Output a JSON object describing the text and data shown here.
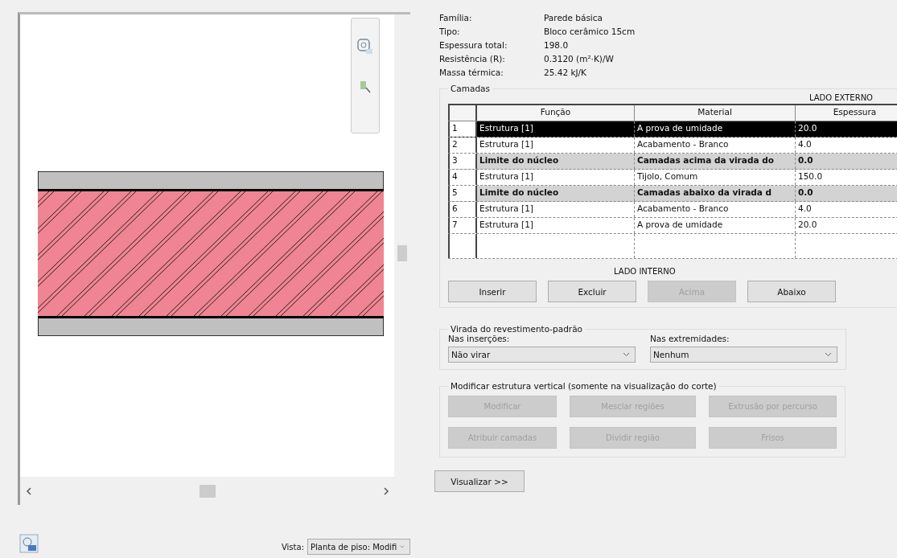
{
  "properties": [
    {
      "label": "Família:",
      "value": "Parede básica"
    },
    {
      "label": "Tipo:",
      "value": "Bloco cerâmico 15cm"
    },
    {
      "label": "Espessura total:",
      "value": "198.0"
    },
    {
      "label": "Resistência (R):",
      "value": "0.3120 (m²·K)/W"
    },
    {
      "label": "Massa térmica:",
      "value": "25.42 kJ/K"
    }
  ],
  "layers": {
    "title": "Camadas",
    "exterior_label": "LADO EXTERNO",
    "interior_label": "LADO INTERNO",
    "columns": [
      "Função",
      "Material",
      "Espessura"
    ],
    "rows": [
      {
        "number": "1",
        "function": "Estrutura [1]",
        "material": "A prova de umidade",
        "thickness": "20.0",
        "kind": "layer",
        "selected": true
      },
      {
        "number": "2",
        "function": "Estrutura [1]",
        "material": "Acabamento - Branco",
        "thickness": "4.0",
        "kind": "layer",
        "selected": false
      },
      {
        "number": "3",
        "function": "Limite do núcleo",
        "material": "Camadas acima da virada do",
        "thickness": "0.0",
        "kind": "core",
        "selected": false
      },
      {
        "number": "4",
        "function": "Estrutura [1]",
        "material": "Tijolo, Comum",
        "thickness": "150.0",
        "kind": "layer",
        "selected": false
      },
      {
        "number": "5",
        "function": "Limite do núcleo",
        "material": "Camadas abaixo da virada d",
        "thickness": "0.0",
        "kind": "core",
        "selected": false
      },
      {
        "number": "6",
        "function": "Estrutura [1]",
        "material": "Acabamento - Branco",
        "thickness": "4.0",
        "kind": "layer",
        "selected": false
      },
      {
        "number": "7",
        "function": "Estrutura [1]",
        "material": "A prova de umidade",
        "thickness": "20.0",
        "kind": "layer",
        "selected": false
      }
    ],
    "buttons": [
      {
        "label": "Inserir",
        "disabled": false
      },
      {
        "label": "Excluir",
        "disabled": false
      },
      {
        "label": "Acima",
        "disabled": true
      },
      {
        "label": "Abaixo",
        "disabled": false
      }
    ]
  },
  "wrap": {
    "title": "Virada do revestimento-padrão",
    "fields": [
      {
        "label": "Nas inserções:",
        "value": "Não virar"
      },
      {
        "label": "Nas extremidades:",
        "value": "Nenhum"
      }
    ]
  },
  "vertical": {
    "title": "Modificar estrutura vertical (somente na visualização do corte)",
    "buttons": [
      {
        "label": "Modificar",
        "disabled": true
      },
      {
        "label": "Mesclar regiões",
        "disabled": true
      },
      {
        "label": "Extrusão por percurso",
        "disabled": true
      },
      {
        "label": "Atribuir camadas",
        "disabled": true
      },
      {
        "label": "Dividir região",
        "disabled": true
      },
      {
        "label": "Frisos",
        "disabled": true
      }
    ]
  },
  "view": {
    "label": "Vista:",
    "value": "Planta de piso: Modifi"
  },
  "preview_button": "Visualizar >>"
}
